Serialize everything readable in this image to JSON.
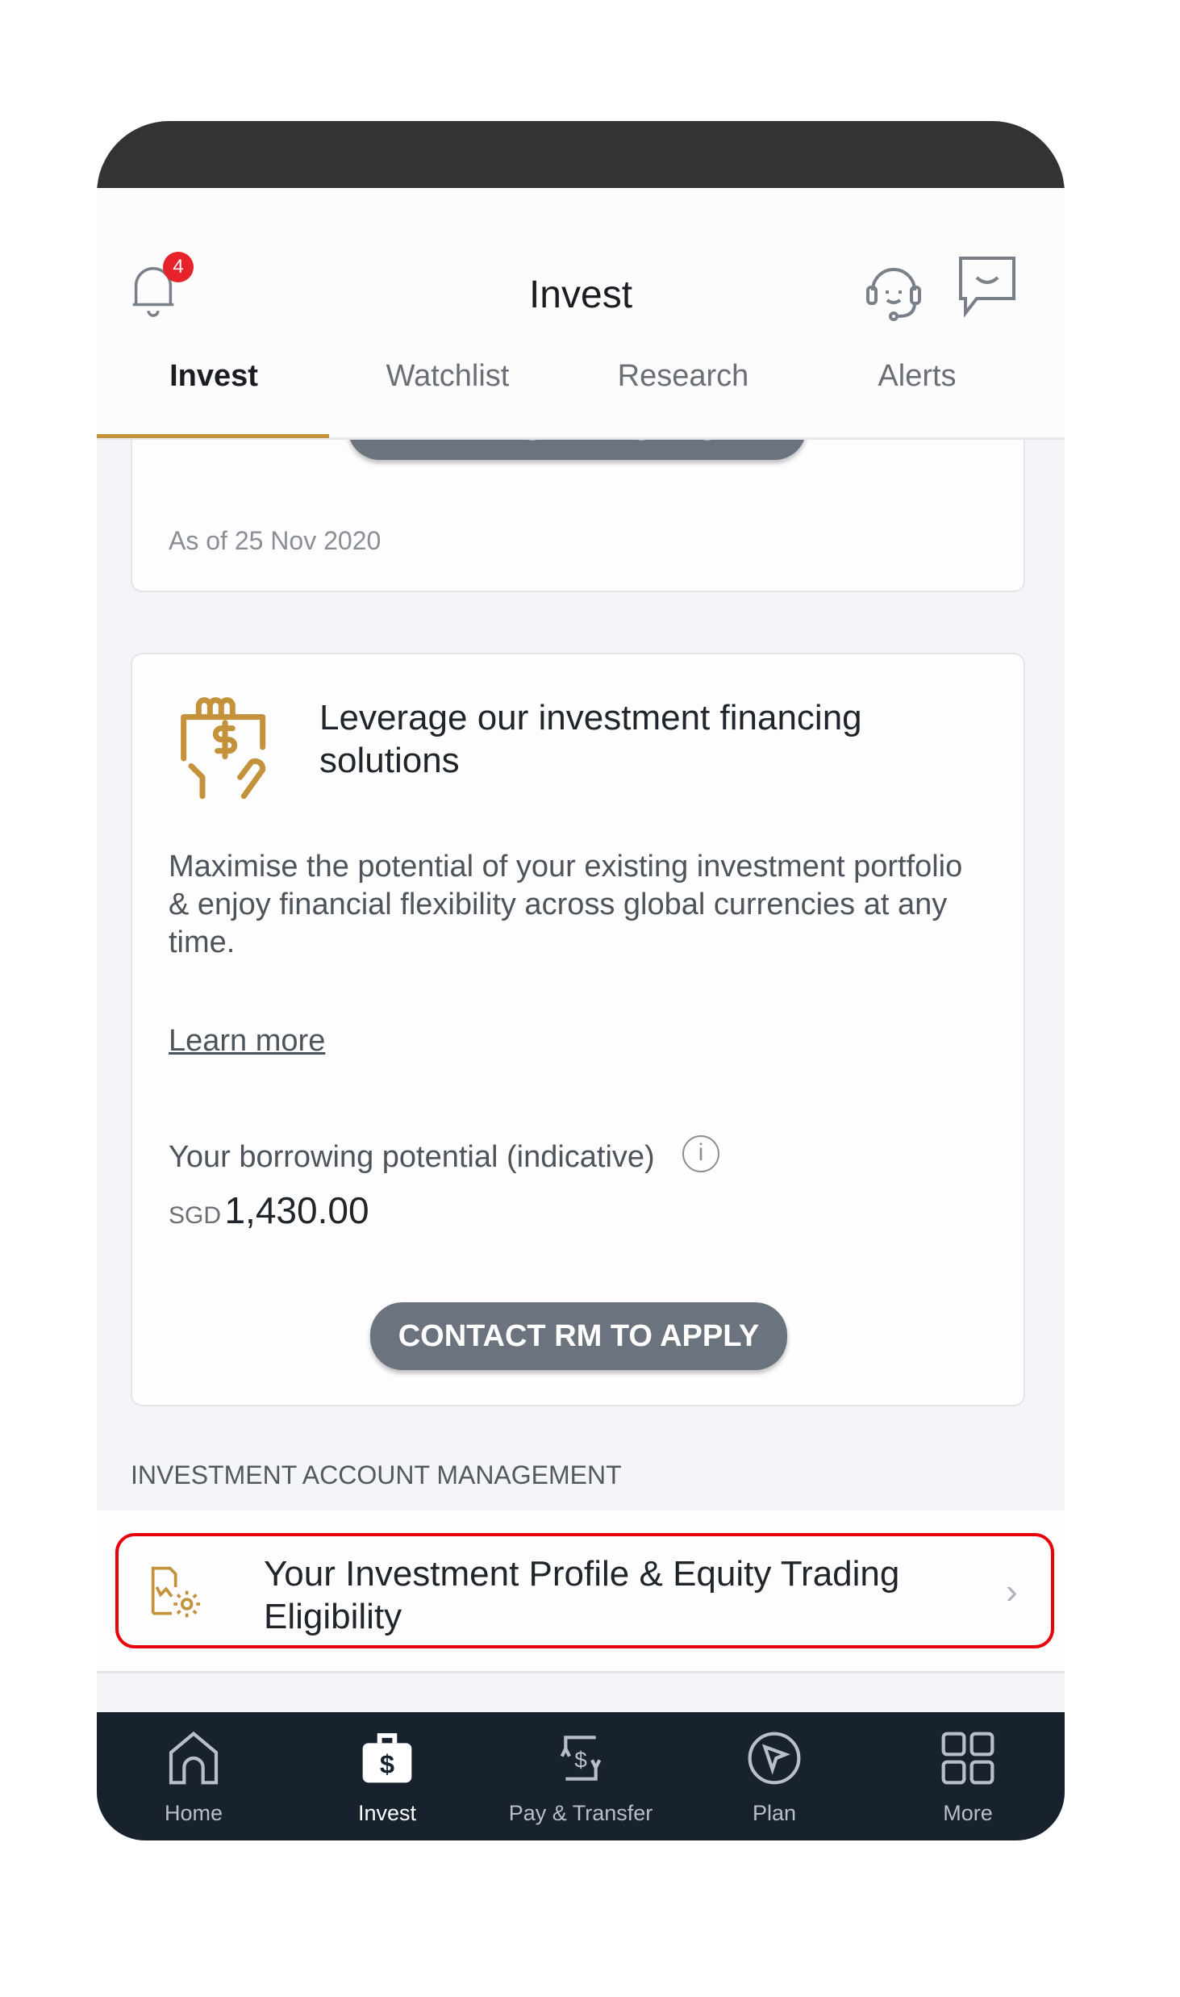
{
  "header": {
    "title": "Invest",
    "notification_count": "4"
  },
  "tabs": [
    {
      "label": "Invest",
      "active": true
    },
    {
      "label": "Watchlist"
    },
    {
      "label": "Research"
    },
    {
      "label": "Alerts"
    }
  ],
  "summary_card": {
    "transfer_button": "TRANSFER FUNDS",
    "as_of": "As of 25 Nov 2020"
  },
  "financing_card": {
    "title": "Leverage our investment financing solutions",
    "description": "Maximise the potential of your existing investment portfolio &  enjoy financial flexibility across global currencies at any time.",
    "learn_more": "Learn more",
    "borrowing_label": "Your borrowing potential (indicative)",
    "currency": "SGD",
    "amount": "1,430.00",
    "contact_button": "CONTACT RM TO APPLY"
  },
  "account_management": {
    "section_label": "INVESTMENT ACCOUNT MANAGEMENT",
    "items": [
      {
        "label": "Your Investment Profile & Equity Trading Eligibility",
        "highlighted": true
      }
    ]
  },
  "bottom_nav": [
    {
      "label": "Home",
      "icon": "home-icon"
    },
    {
      "label": "Invest",
      "icon": "briefcase-dollar-icon",
      "active": true
    },
    {
      "label": "Pay & Transfer",
      "icon": "transfer-icon"
    },
    {
      "label": "Plan",
      "icon": "compass-icon"
    },
    {
      "label": "More",
      "icon": "grid-icon"
    }
  ],
  "colors": {
    "accent": "#c4923a",
    "highlight": "#e8000b",
    "nav_bg": "#17222e",
    "button": "#6b747e",
    "badge": "#e8222a"
  }
}
